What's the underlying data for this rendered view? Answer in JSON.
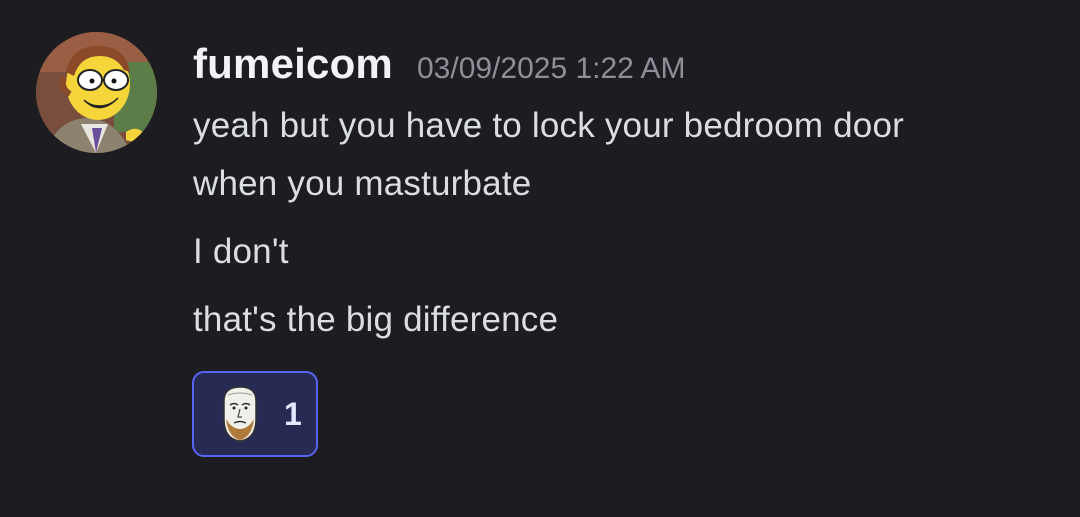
{
  "message": {
    "username": "fumeicom",
    "timestamp": "03/09/2025 1:22 AM",
    "lines": [
      "yeah but you have to lock your bedroom door",
      "when you masturbate",
      "I don't",
      "that's the big difference"
    ],
    "avatar_icon": "cartoon-man-with-glasses-avatar"
  },
  "reaction": {
    "emoji_icon": "wojak-face-emoji",
    "count": "1",
    "selected": true,
    "accent_color": "#5865f2"
  },
  "colors": {
    "background": "#1c1c21",
    "username": "#f2f3f5",
    "timestamp": "#8e9099",
    "text": "#dbdee1"
  }
}
